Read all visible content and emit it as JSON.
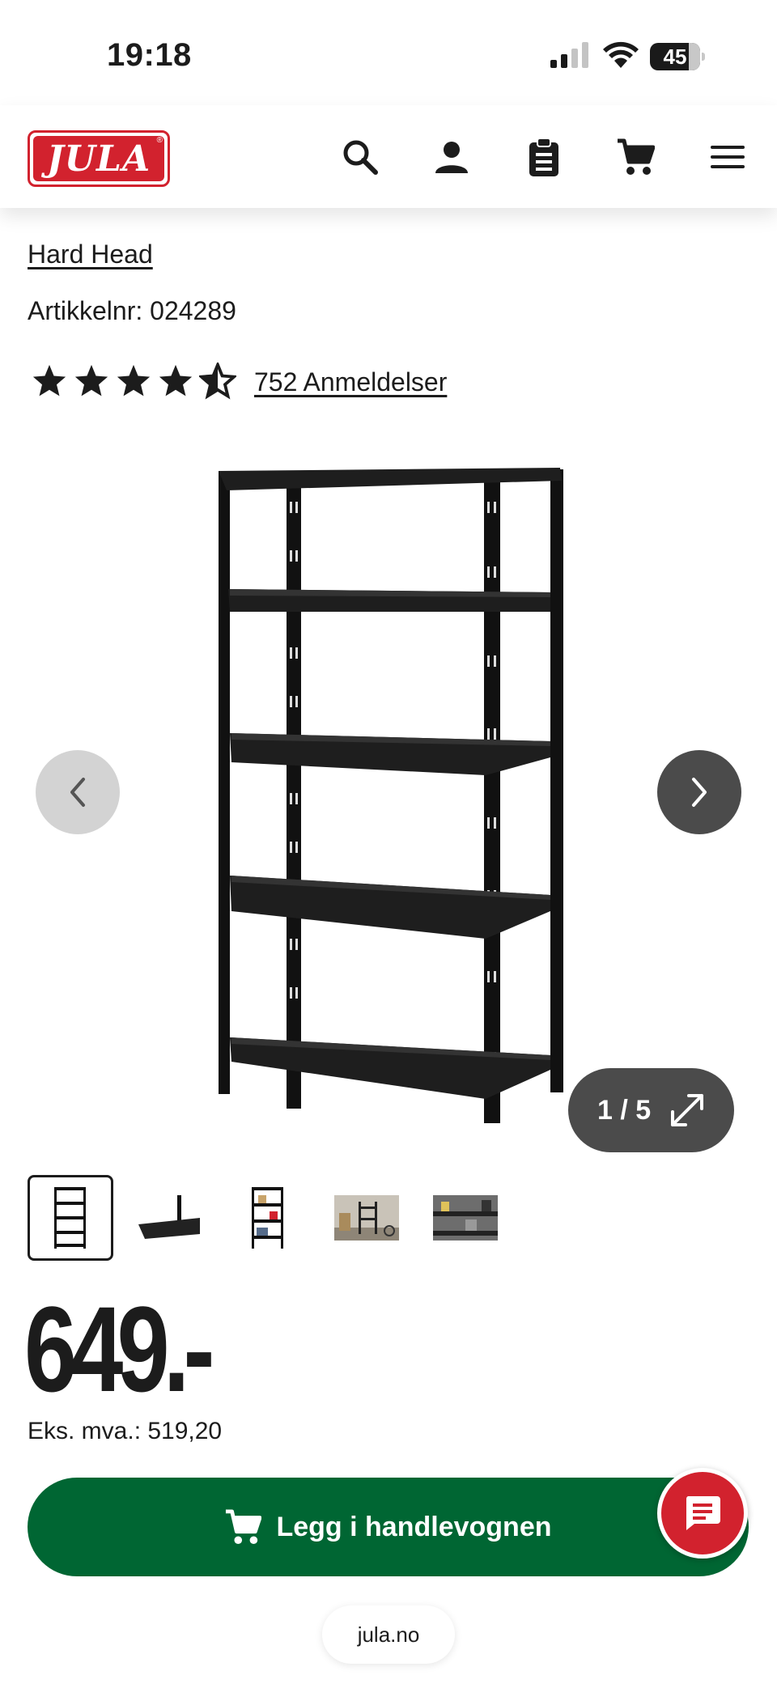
{
  "status_bar": {
    "time": "19:18",
    "battery": "45"
  },
  "header": {
    "logo_text": "JULA",
    "icons": [
      "search-icon",
      "account-icon",
      "shopping-list-icon",
      "cart-icon",
      "menu-icon"
    ]
  },
  "product": {
    "brand": "Hard Head",
    "article_number": "Artikkelnr: 024289",
    "rating": 4.5,
    "reviews_label": "752 Anmeldelser",
    "image_counter": "1 / 5",
    "thumbnails": [
      "thumbnail-1",
      "thumbnail-2",
      "thumbnail-3",
      "thumbnail-4",
      "thumbnail-5"
    ],
    "price": "649.-",
    "price_ex_vat": "Eks. mva.: 519,20"
  },
  "actions": {
    "add_to_cart": "Legg i handlevognen"
  },
  "browser": {
    "url": "jula.no"
  },
  "colors": {
    "brand_red": "#d2222e",
    "cart_green": "#006633",
    "carousel_dark": "#4b4b4b"
  }
}
